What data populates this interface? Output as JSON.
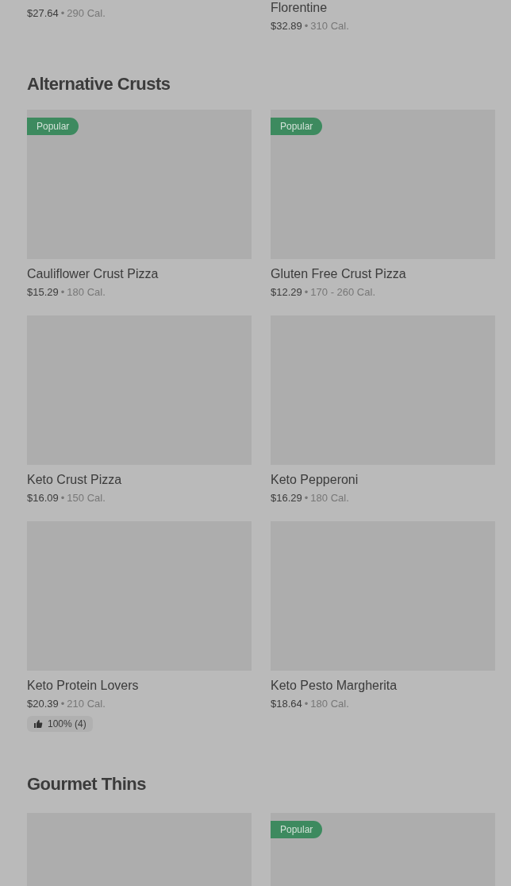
{
  "sections": [
    {
      "items": [
        {
          "kind": "text",
          "price": "$27.64",
          "separator": "•",
          "calories": "290 Cal."
        },
        {
          "kind": "text",
          "name": "Florentine",
          "price": "$32.89",
          "separator": "•",
          "calories": "310 Cal."
        }
      ]
    },
    {
      "title": "Alternative Crusts",
      "items": [
        {
          "kind": "card",
          "badge": "Popular",
          "name": "Cauliflower Crust Pizza",
          "price": "$15.29",
          "separator": "•",
          "calories": "180 Cal."
        },
        {
          "kind": "card",
          "badge": "Popular",
          "name": "Gluten Free Crust Pizza",
          "price": "$12.29",
          "separator": "•",
          "calories": "170 - 260 Cal."
        },
        {
          "kind": "card",
          "name": "Keto Crust Pizza",
          "price": "$16.09",
          "separator": "•",
          "calories": "150 Cal."
        },
        {
          "kind": "card",
          "name": "Keto Pepperoni",
          "price": "$16.29",
          "separator": "•",
          "calories": "180 Cal."
        },
        {
          "kind": "card",
          "name": "Keto Protein Lovers",
          "price": "$20.39",
          "separator": "•",
          "calories": "210 Cal.",
          "rating": "100% (4)"
        },
        {
          "kind": "card",
          "name": "Keto Pesto Margherita",
          "price": "$18.64",
          "separator": "•",
          "calories": "180 Cal."
        }
      ]
    },
    {
      "title": "Gourmet Thins",
      "items": [
        {
          "kind": "card"
        },
        {
          "kind": "card",
          "badge": "Popular"
        }
      ]
    }
  ]
}
